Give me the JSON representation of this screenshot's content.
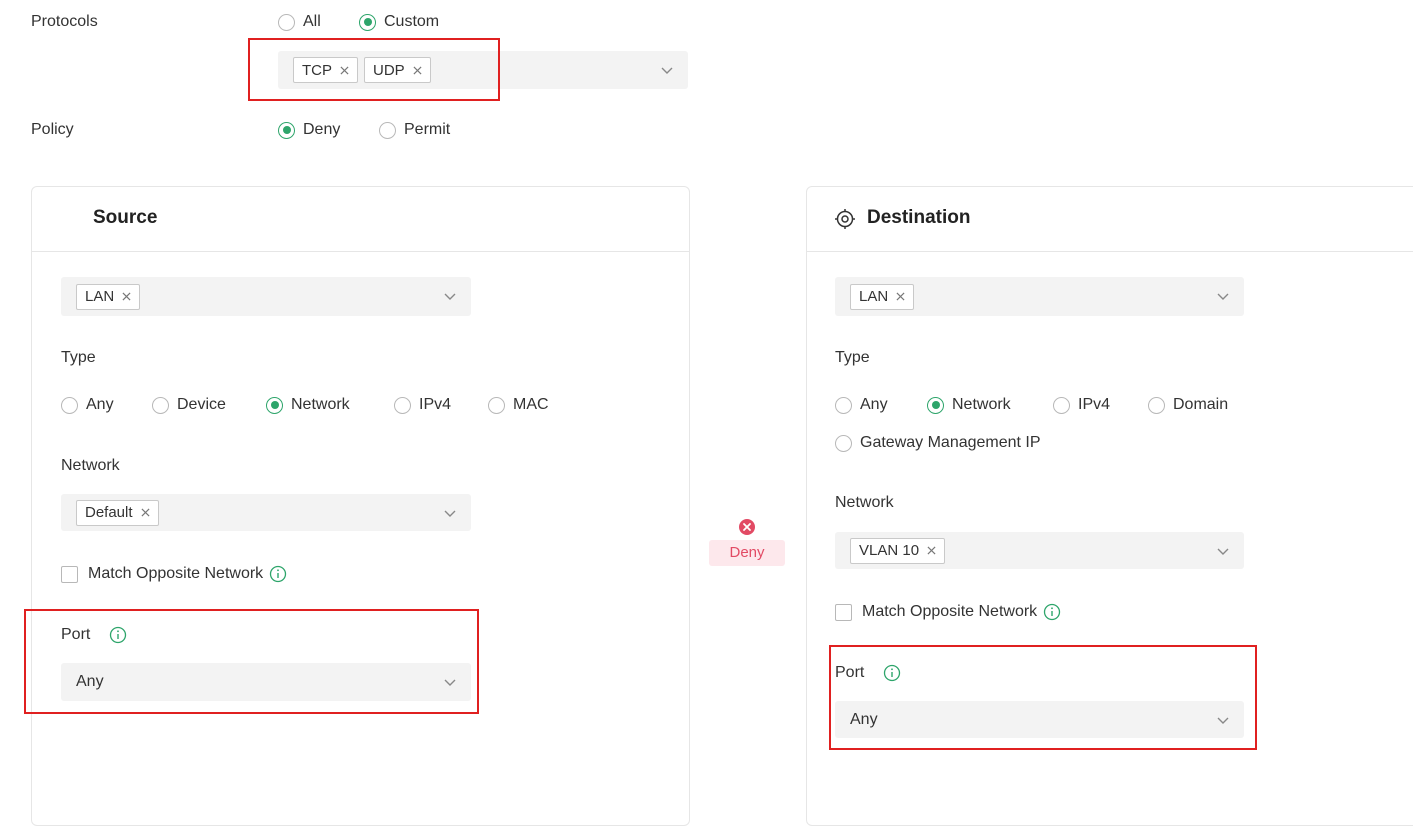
{
  "protocols": {
    "label": "Protocols",
    "options": [
      "All",
      "Custom"
    ],
    "selected": "Custom",
    "tags": [
      "TCP",
      "UDP"
    ]
  },
  "policy": {
    "label": "Policy",
    "options": [
      "Deny",
      "Permit"
    ],
    "selected": "Deny"
  },
  "source": {
    "title": "Source",
    "interface_tags": [
      "LAN"
    ],
    "type_label": "Type",
    "type_options": [
      "Any",
      "Device",
      "Network",
      "IPv4",
      "MAC"
    ],
    "type_selected": "Network",
    "network_label": "Network",
    "network_tags": [
      "Default"
    ],
    "match_opposite_label": "Match Opposite Network",
    "port_label": "Port",
    "port_value": "Any"
  },
  "policy_indicator": {
    "label": "Deny"
  },
  "destination": {
    "title": "Destination",
    "interface_tags": [
      "LAN"
    ],
    "type_label": "Type",
    "type_options": [
      "Any",
      "Network",
      "IPv4",
      "Domain",
      "Gateway Management IP"
    ],
    "type_selected": "Network",
    "network_label": "Network",
    "network_tags": [
      "VLAN 10"
    ],
    "match_opposite_label": "Match Opposite Network",
    "port_label": "Port",
    "port_value": "Any"
  },
  "colors": {
    "accent_green": "#2ea56b",
    "deny_red": "#e24a64",
    "highlight_red": "#e02020",
    "field_bg": "#f3f3f3"
  }
}
